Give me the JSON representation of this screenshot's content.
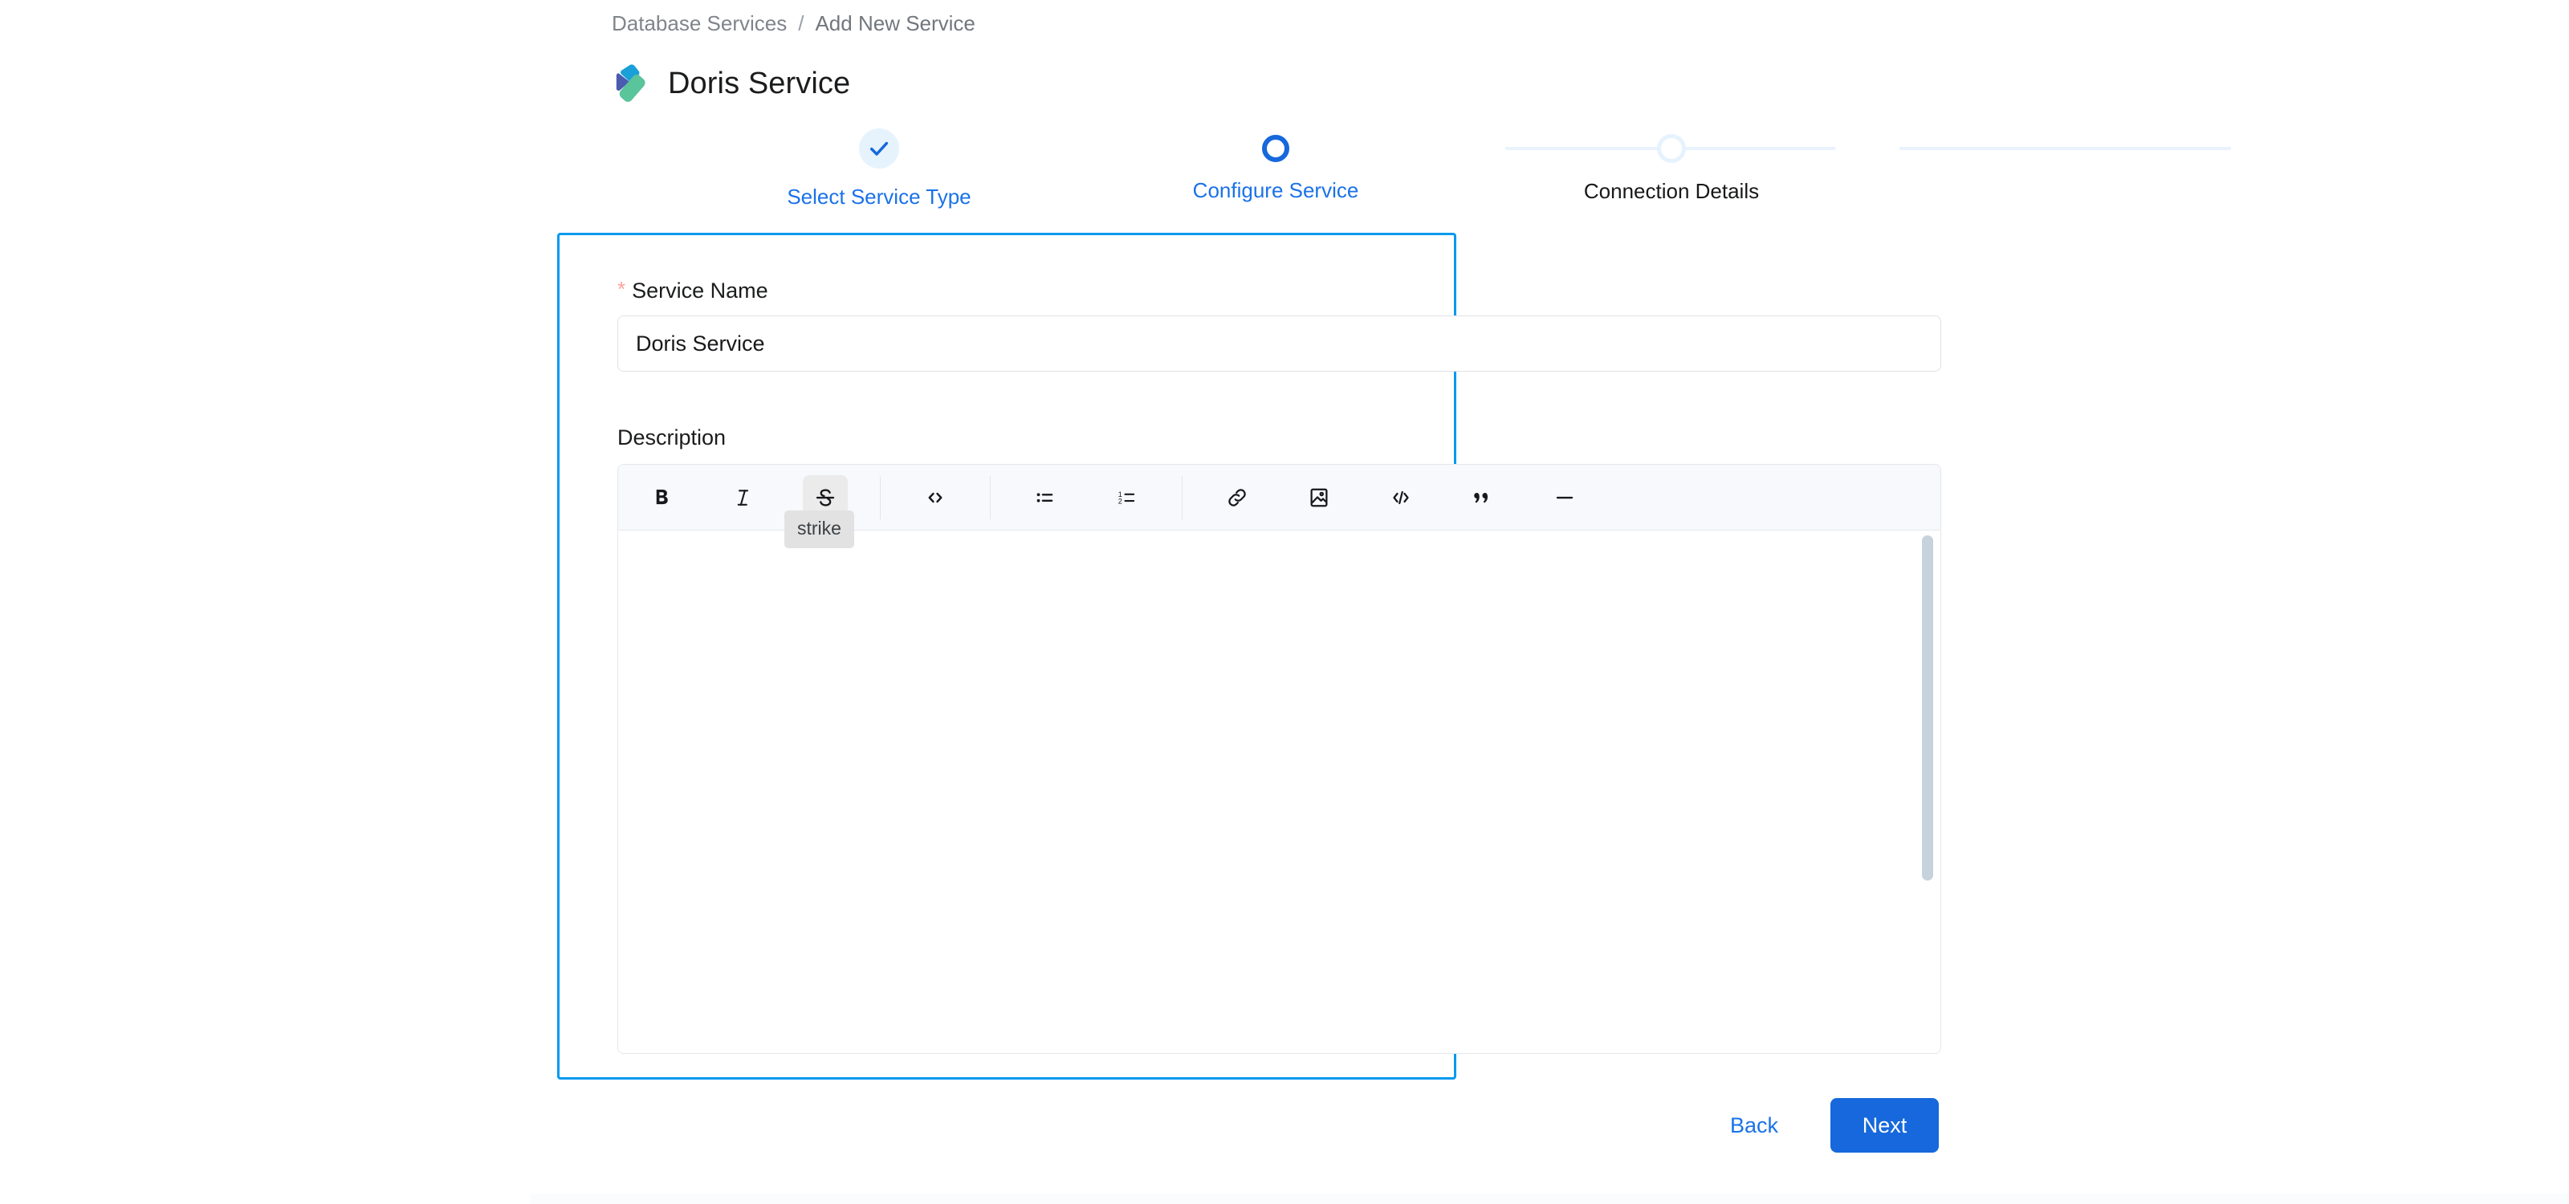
{
  "breadcrumb": {
    "items": [
      "Database Services",
      "Add New Service"
    ],
    "separator": "/"
  },
  "header": {
    "title": "Doris Service",
    "logo_icon": "doris-logo-icon",
    "logo_colors": {
      "cyan": "#1aa0d8",
      "indigo": "#4a5bb0",
      "green": "#5ac49a"
    }
  },
  "stepper": {
    "steps": [
      {
        "label": "Select Service Type",
        "state": "done",
        "icon": "check-icon"
      },
      {
        "label": "Configure Service",
        "state": "active",
        "icon": "circle-icon"
      },
      {
        "label": "Connection Details",
        "state": "todo",
        "icon": "circle-outline-icon"
      }
    ],
    "colors": {
      "active": "#1668dc",
      "label_active": "#1a72e8",
      "label_todo": "#17181a",
      "track": "#e9f3fd",
      "todo_ring": "#e6f2fd",
      "done_bg": "#e6f3fd"
    }
  },
  "form": {
    "focus_border_color": "#0099f0",
    "service_name": {
      "label": "Service Name",
      "required_marker": "*",
      "value": "Doris Service",
      "placeholder": ""
    },
    "description": {
      "label": "Description",
      "value": "",
      "placeholder": ""
    }
  },
  "editor_toolbar": {
    "buttons": [
      {
        "name": "bold-button",
        "glyph": "B",
        "tooltip": "bold",
        "state": "normal"
      },
      {
        "name": "italic-button",
        "glyph": "I",
        "tooltip": "italic",
        "state": "normal"
      },
      {
        "name": "strike-button",
        "glyph": "S",
        "tooltip": "strike",
        "state": "hovered"
      },
      {
        "name": "inline-code-button",
        "glyph": "< >",
        "tooltip": "code",
        "state": "normal"
      },
      {
        "name": "bullet-list-button",
        "glyph": "bullet-list",
        "tooltip": "bullet list",
        "state": "normal"
      },
      {
        "name": "ordered-list-button",
        "glyph": "ordered-list",
        "tooltip": "ordered list",
        "state": "normal"
      },
      {
        "name": "link-button",
        "glyph": "link",
        "tooltip": "link",
        "state": "normal"
      },
      {
        "name": "image-button",
        "glyph": "image",
        "tooltip": "image",
        "state": "normal"
      },
      {
        "name": "code-block-button",
        "glyph": "</>",
        "tooltip": "code block",
        "state": "normal"
      },
      {
        "name": "blockquote-button",
        "glyph": "quote",
        "tooltip": "blockquote",
        "state": "normal"
      },
      {
        "name": "horizontal-rule-button",
        "glyph": "—",
        "tooltip": "divider",
        "state": "normal"
      }
    ],
    "visible_tooltip": "strike",
    "background": "#f7f9fc",
    "hover_background": "#ebebeb",
    "tooltip_background": "#e2e2e2"
  },
  "footer": {
    "back_label": "Back",
    "next_label": "Next",
    "next_color": "#1668dc",
    "back_color": "#1a72e8"
  }
}
